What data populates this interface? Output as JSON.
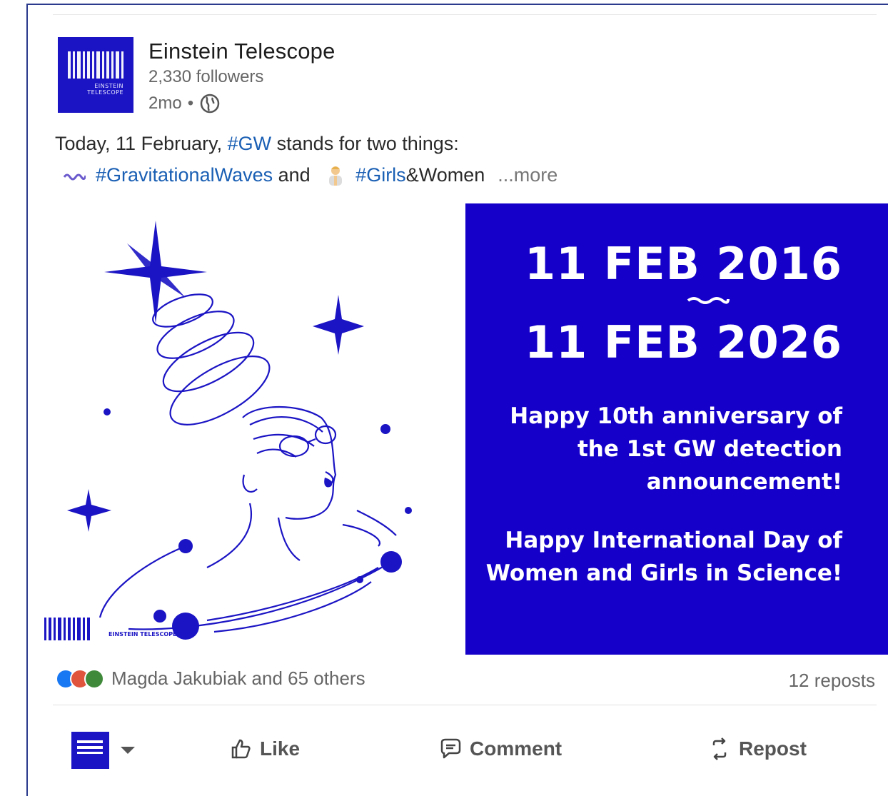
{
  "post": {
    "author": "Einstein Telescope",
    "logo_caption": "EINSTEIN TELESCOPE",
    "followers": "2,330 followers",
    "age": "2mo",
    "separator": "•",
    "visibility_icon": "globe-icon",
    "text": {
      "line1_prefix": "Today, 11 February, ",
      "line1_hashtag": "#GW",
      "line1_suffix": " stands for two things:",
      "line2_tag1": "#GravitationalWaves",
      "line2_and": " and ",
      "line2_tag2": "#Girls",
      "line2_tail": "&Women",
      "more": "...more"
    }
  },
  "image": {
    "date_from": "11 FEB 2016",
    "date_to": "11 FEB 2026",
    "anniversary": "Happy 10th anniversary of the 1st GW detection announcement!",
    "intl_day": "Happy International Day of Women and Girls in Science!",
    "illustration_caption": "EINSTEIN TELESCOPE",
    "brand_color": "#1400c8"
  },
  "social": {
    "reactions_text": "Magda Jakubiak and 65 others",
    "reposts": "12 reposts"
  },
  "actions": {
    "like": "Like",
    "comment": "Comment",
    "repost": "Repost"
  }
}
